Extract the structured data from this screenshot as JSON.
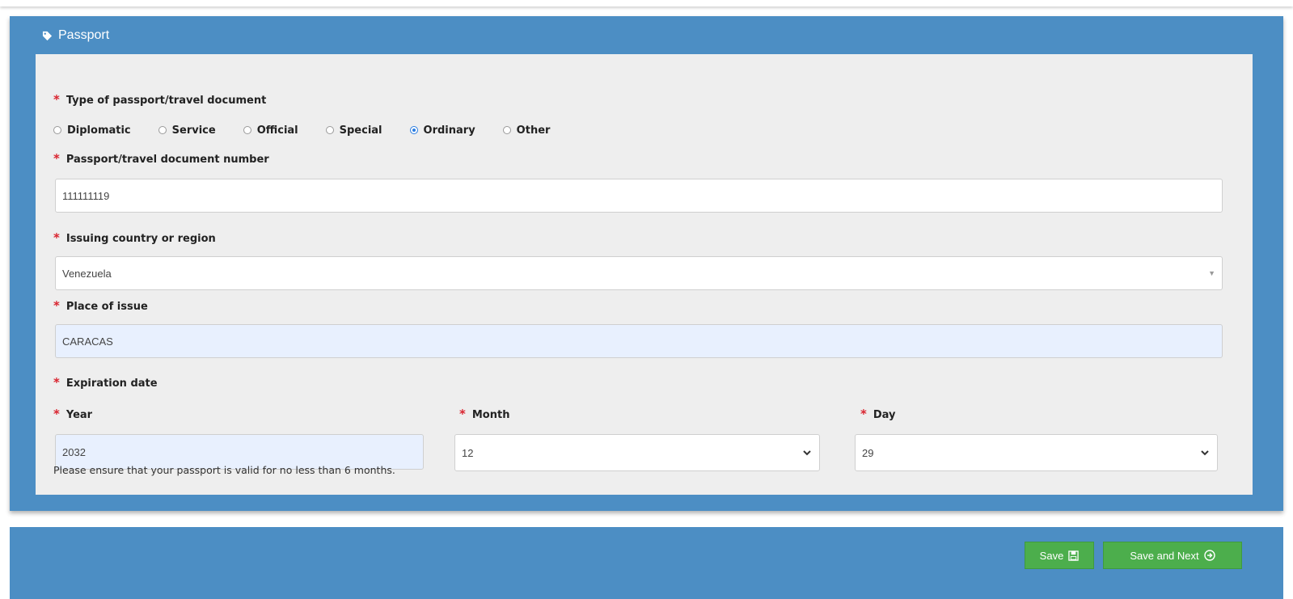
{
  "panel": {
    "title": "Passport",
    "icon": "tag-icon"
  },
  "form": {
    "doc_type": {
      "label": "Type of passport/travel document",
      "required_mark": "*",
      "options": [
        {
          "label": "Diplomatic",
          "checked": false
        },
        {
          "label": "Service",
          "checked": false
        },
        {
          "label": "Official",
          "checked": false
        },
        {
          "label": "Special",
          "checked": false
        },
        {
          "label": "Ordinary",
          "checked": true
        },
        {
          "label": "Other",
          "checked": false
        }
      ]
    },
    "doc_number": {
      "label": "Passport/travel document number",
      "required_mark": "*",
      "value": "111111119"
    },
    "issuing_country": {
      "label": "Issuing country or region",
      "required_mark": "*",
      "value": "Venezuela"
    },
    "place_of_issue": {
      "label": "Place of issue",
      "required_mark": "*",
      "value": "CARACAS"
    },
    "expiration": {
      "label": "Expiration date",
      "required_mark": "*",
      "year": {
        "label": "Year",
        "required_mark": "*",
        "value": "2032"
      },
      "month": {
        "label": "Month",
        "required_mark": "*",
        "value": "12"
      },
      "day": {
        "label": "Day",
        "required_mark": "*",
        "value": "29"
      },
      "note": "Please ensure that your passport is valid for no less than 6 months."
    }
  },
  "footer": {
    "save_label": "Save",
    "save_next_label": "Save and Next",
    "accent": "#4cae4c"
  },
  "colors": {
    "panel_blue": "#4c8ec4",
    "required_red": "#d9232e",
    "radio_blue": "#2b7de0"
  }
}
